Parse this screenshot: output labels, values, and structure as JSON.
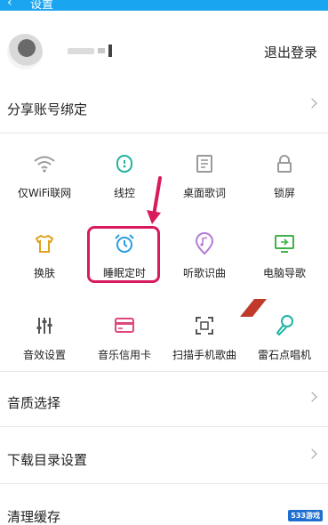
{
  "header": {
    "title": "设置",
    "back_icon": "back-arrow-icon",
    "color": "#1aa5f0"
  },
  "profile": {
    "logout_label": "退出登录"
  },
  "share": {
    "label": "分享账号绑定"
  },
  "grid": {
    "items": [
      {
        "label": "仅WiFi联网",
        "icon": "wifi-icon"
      },
      {
        "label": "线控",
        "icon": "wire-control-icon"
      },
      {
        "label": "桌面歌词",
        "icon": "desktop-lyrics-icon"
      },
      {
        "label": "锁屏",
        "icon": "lock-icon"
      },
      {
        "label": "换肤",
        "icon": "shirt-icon"
      },
      {
        "label": "睡眠定时",
        "icon": "alarm-clock-icon"
      },
      {
        "label": "听歌识曲",
        "icon": "music-recognition-icon"
      },
      {
        "label": "电脑导歌",
        "icon": "computer-import-icon"
      },
      {
        "label": "音效设置",
        "icon": "equalizer-icon"
      },
      {
        "label": "音乐信用卡",
        "icon": "credit-card-icon"
      },
      {
        "label": "扫描手机歌曲",
        "icon": "scan-icon"
      },
      {
        "label": "雷石点唱机",
        "icon": "microphone-icon"
      }
    ],
    "highlight_color": "#d81b5e"
  },
  "settings": {
    "quality": "音质选择",
    "download_dir": "下载目录设置",
    "clear_cache": "清理缓存"
  },
  "watermark": {
    "text": "533游戏"
  }
}
